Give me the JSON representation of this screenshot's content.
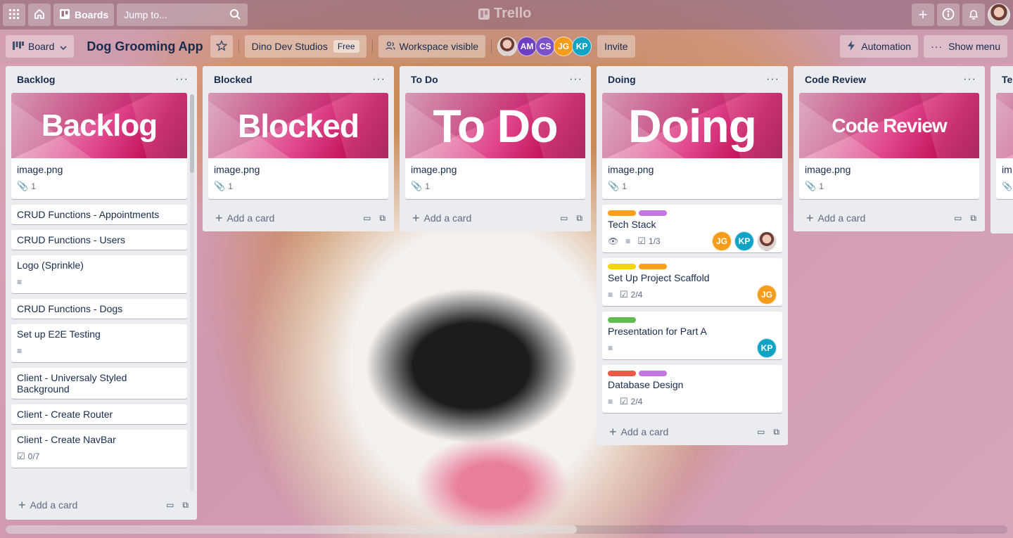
{
  "topbar": {
    "boards_label": "Boards",
    "search_placeholder": "Jump to...",
    "brand": "Trello"
  },
  "board": {
    "view_label": "Board",
    "title": "Dog Grooming App",
    "workspace": "Dino Dev Studios",
    "workspace_plan": "Free",
    "visibility": "Workspace visible",
    "members": [
      {
        "initials": "AM",
        "color": "#6e3fc1"
      },
      {
        "initials": "CS",
        "color": "#7b52c9"
      },
      {
        "initials": "JG",
        "color": "#f59c1a"
      },
      {
        "initials": "KP",
        "color": "#11a3c4"
      }
    ],
    "invite_label": "Invite",
    "automation_label": "Automation",
    "show_menu_label": "Show menu"
  },
  "lists": {
    "backlog": {
      "title": "Backlog",
      "cover_text": "Backlog",
      "cover_card_title": "image.png",
      "cover_attachments": "1",
      "cards": [
        {
          "title": "CRUD Functions - Appointments"
        },
        {
          "title": "CRUD Functions - Users"
        },
        {
          "title": "Logo (Sprinkle)"
        },
        {
          "title": "CRUD Functions - Dogs"
        },
        {
          "title": "Set up E2E Testing"
        },
        {
          "title": "Client - Universaly Styled Background"
        },
        {
          "title": "Client - Create Router"
        },
        {
          "title": "Client - Create NavBar",
          "checklist": "0/7"
        }
      ],
      "add_label": "Add a card"
    },
    "blocked": {
      "title": "Blocked",
      "cover_text": "Blocked",
      "cover_card_title": "image.png",
      "cover_attachments": "1",
      "add_label": "Add a card"
    },
    "todo": {
      "title": "To Do",
      "cover_text": "To Do",
      "cover_card_title": "image.png",
      "cover_attachments": "1",
      "add_label": "Add a card"
    },
    "doing": {
      "title": "Doing",
      "cover_text": "Doing",
      "cover_card_title": "image.png",
      "cover_attachments": "1",
      "cards": [
        {
          "title": "Tech Stack",
          "checklist": "1/3",
          "labels": [
            "#ff9f1a",
            "#c377e0"
          ],
          "members": [
            "JG",
            "KP"
          ]
        },
        {
          "title": "Set Up Project Scaffold",
          "checklist": "2/4",
          "labels": [
            "#f2d600",
            "#ff9f1a"
          ],
          "members": [
            "JG"
          ]
        },
        {
          "title": "Presentation for Part A",
          "labels": [
            "#61bd4f"
          ],
          "members": [
            "KP"
          ]
        },
        {
          "title": "Database Design",
          "checklist": "2/4",
          "labels": [
            "#eb5a46",
            "#c377e0"
          ]
        }
      ],
      "add_label": "Add a card"
    },
    "code_review": {
      "title": "Code Review",
      "cover_text": "Code Review",
      "cover_card_title": "image.png",
      "cover_attachments": "1",
      "add_label": "Add a card"
    },
    "partial": {
      "title": "Te",
      "cover_card_title": "im"
    }
  }
}
